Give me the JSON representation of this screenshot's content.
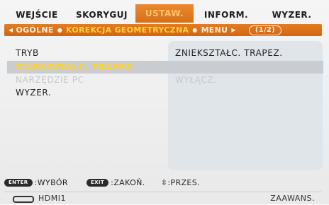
{
  "tabs": [
    {
      "label": "WEJŚCIE",
      "active": false
    },
    {
      "label": "SKORYGUJ",
      "active": false
    },
    {
      "label": "USTAW.",
      "active": true
    },
    {
      "label": "INFORM.",
      "active": false
    },
    {
      "label": "WYZER.",
      "active": false
    }
  ],
  "subnav": {
    "items": [
      "OGÓLNE",
      "KOREKCJA GEOMETRYCZNA",
      "MENU"
    ],
    "current_index": 1,
    "page": "(1/2)"
  },
  "menu": {
    "rows": [
      {
        "label": "TRYB",
        "value": "ZNIEKSZTAŁC. TRAPEZ.",
        "state": "normal"
      },
      {
        "label": "ZNIEKSZTAŁC. TRAPEZ.",
        "value": "",
        "state": "selected"
      },
      {
        "label": "NARZĘDZIE PC",
        "value": "WYŁĄCZ.",
        "state": "disabled"
      },
      {
        "label": "WYZER.",
        "value": "",
        "state": "normal"
      }
    ]
  },
  "hints": {
    "enter_key": "ENTER",
    "enter_text": ":WYBÓR",
    "exit_key": "EXIT",
    "exit_text": ":ZAKOŃ.",
    "move_glyph": "⇳",
    "move_text": ":PRZES."
  },
  "status": {
    "source": "HDMI1",
    "mode": "ZAAWANS."
  },
  "colors": {
    "accent": "#e07a20",
    "selected_text": "#ffd42a",
    "disabled_text": "#c4c8cc",
    "panel": "#e0e5ea"
  }
}
